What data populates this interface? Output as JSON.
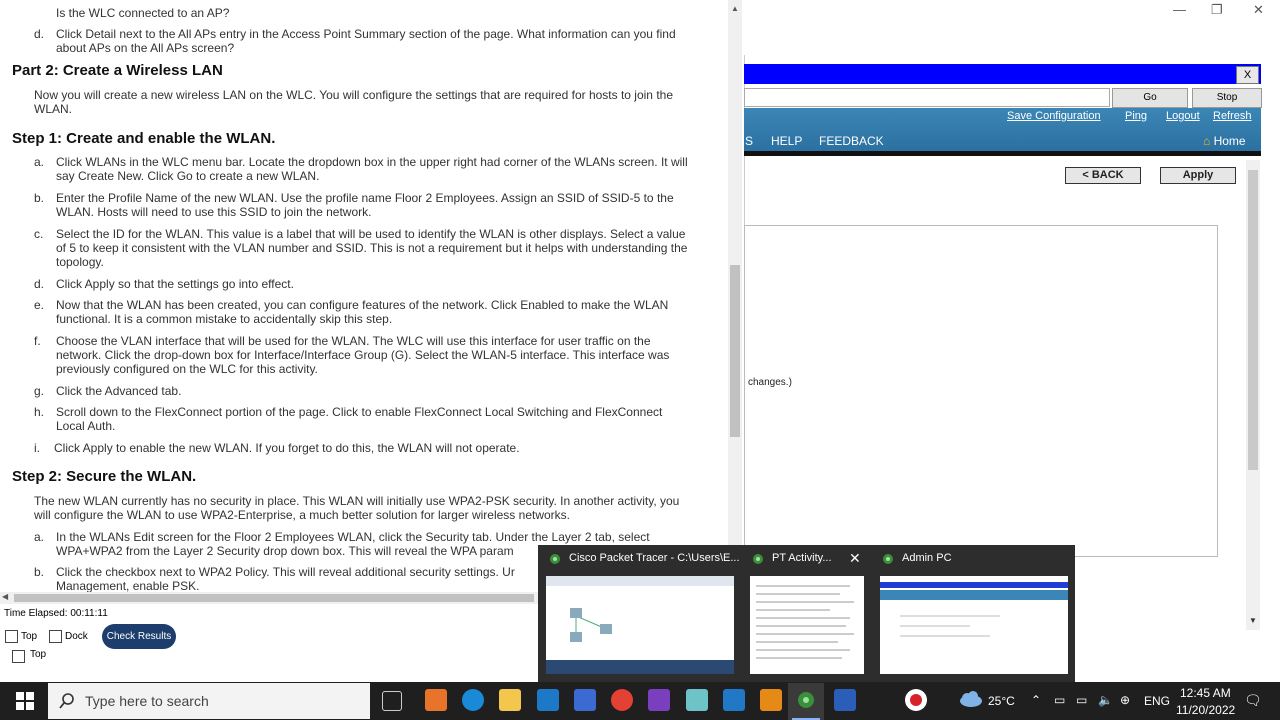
{
  "doc": {
    "q_c_tail": "Is the WLC connected to an AP?",
    "q_d_letter": "d.",
    "q_d_line1": "Click Detail next to the All APs entry in the Access Point Summary section of the page. What information can you find",
    "q_d_line2": "about APs on the All APs screen?",
    "part2_heading": "Part 2: Create a Wireless LAN",
    "part2_intro1": "Now you will create a new wireless LAN on the WLC. You will configure the settings that are required for hosts to join the",
    "part2_intro2": "WLAN.",
    "step1_heading": "Step 1: Create and enable the WLAN.",
    "step1": [
      {
        "letter": "a.",
        "lines": [
          "Click WLANs in the WLC menu bar. Locate the dropdown box in the upper right had corner of the WLANs screen. It will",
          "say Create New. Click Go to create a new WLAN."
        ]
      },
      {
        "letter": "b.",
        "lines": [
          "Enter the Profile Name of the new WLAN. Use the profile name Floor 2 Employees. Assign an SSID of SSID-5 to the",
          "WLAN. Hosts will need to use this SSID to join the network."
        ]
      },
      {
        "letter": "c.",
        "lines": [
          "Select the ID for the WLAN. This value is a label that will be used to identify the WLAN is other displays. Select a value",
          "of 5 to keep it consistent with the VLAN number and SSID. This is not a requirement but it helps with understanding the",
          "topology."
        ]
      },
      {
        "letter": "d.",
        "lines": [
          "Click Apply so that the settings go into effect."
        ]
      },
      {
        "letter": "e.",
        "lines": [
          "Now that the WLAN has been created, you can configure features of the network. Click Enabled to make the WLAN",
          "functional. It is a common mistake to accidentally skip this step."
        ]
      },
      {
        "letter": "f.",
        "lines": [
          "Choose the VLAN interface that will be used for the WLAN. The WLC will use this interface for user traffic on the",
          "network. Click the drop-down box for Interface/Interface Group (G). Select the WLAN-5 interface. This interface was",
          "previously configured on the WLC for this activity."
        ]
      },
      {
        "letter": "g.",
        "lines": [
          "Click the Advanced tab."
        ]
      },
      {
        "letter": "h.",
        "lines": [
          "Scroll down to the FlexConnect portion of the page. Click to enable FlexConnect Local Switching and FlexConnect",
          "Local Auth."
        ]
      },
      {
        "letter": "i.",
        "lines": [
          "Click Apply to enable the new WLAN. If you forget to do this, the WLAN will not operate."
        ]
      }
    ],
    "step2_heading": "Step 2: Secure the WLAN.",
    "step2_intro1": "The new WLAN currently has no security in place. This WLAN will initially use WPA2-PSK security. In another activity, you",
    "step2_intro2": "will configure the WLAN to use WPA2-Enterprise, a much better solution for larger wireless networks.",
    "step2": [
      {
        "letter": "a.",
        "lines": [
          "In the WLANs Edit screen for the Floor 2 Employees WLAN, click the Security tab. Under the Layer 2 tab, select",
          "WPA+WPA2 from the Layer 2 Security drop down box. This will reveal the WPA param"
        ]
      },
      {
        "letter": "b.",
        "lines": [
          "Click the checkbox next to WPA2 Policy. This will reveal additional security settings. Ur",
          "Management, enable PSK."
        ]
      }
    ]
  },
  "activity": {
    "time_elapsed": "Time Elapsed: 00:11:11",
    "top_label": "Top",
    "dock_label": "Dock",
    "check_results": "Check Results",
    "top_label2": "Top"
  },
  "browser": {
    "close_x": "X",
    "go": "Go",
    "stop": "Stop",
    "links": [
      "Save Configuration",
      "Ping",
      "Logout",
      "Refresh"
    ],
    "menu": [
      "S",
      "HELP",
      "FEEDBACK"
    ],
    "home": "Home",
    "back": "< BACK",
    "apply": "Apply",
    "changes_note": "changes.)"
  },
  "thumbnails": [
    {
      "title": "Cisco Packet Tracer - C:\\Users\\E..."
    },
    {
      "title": "PT Activity..."
    },
    {
      "title": "Admin PC"
    }
  ],
  "taskbar": {
    "search_placeholder": "Type here to search",
    "weather": "25°C",
    "lang": "ENG",
    "time": "12:45 AM",
    "date": "11/20/2022"
  },
  "colors": {
    "titlebar_blue": "#0000ff",
    "cisco_nav": "#2f78a8",
    "check_btn": "#1d3e6c",
    "taskbar": "#1f1f1f"
  }
}
